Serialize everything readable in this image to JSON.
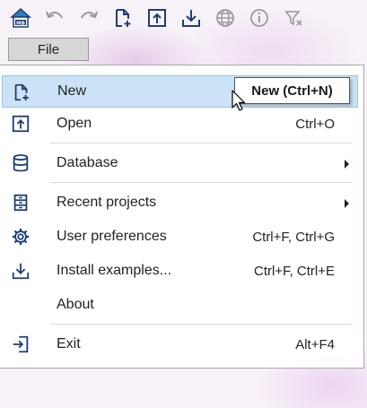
{
  "toolbar": {
    "buttons": [
      {
        "icon": "app-logo-icon"
      },
      {
        "icon": "undo-icon"
      },
      {
        "icon": "redo-icon"
      },
      {
        "icon": "new-document-icon"
      },
      {
        "icon": "open-icon"
      },
      {
        "icon": "download-icon"
      },
      {
        "icon": "globe-icon"
      },
      {
        "icon": "info-icon"
      },
      {
        "icon": "clear-filter-icon"
      }
    ]
  },
  "menubar": {
    "file_label": "File"
  },
  "menu": {
    "items": [
      {
        "label": "New",
        "shortcut": "",
        "icon": "new-document-icon",
        "highlighted": true
      },
      {
        "label": "Open",
        "shortcut": "Ctrl+O",
        "icon": "open-icon"
      },
      {
        "label": "Database",
        "shortcut": "",
        "icon": "database-icon",
        "submenu": true
      },
      {
        "label": "Recent projects",
        "shortcut": "",
        "icon": "recent-projects-icon",
        "submenu": true
      },
      {
        "label": "User preferences",
        "shortcut": "Ctrl+F, Ctrl+G",
        "icon": "gear-icon"
      },
      {
        "label": "Install examples...",
        "shortcut": "Ctrl+F, Ctrl+E",
        "icon": "download-icon"
      },
      {
        "label": "About",
        "shortcut": "",
        "icon": ""
      },
      {
        "label": "Exit",
        "shortcut": "Alt+F4",
        "icon": "exit-icon"
      }
    ]
  },
  "tooltip": {
    "text": "New (Ctrl+N)"
  },
  "colors": {
    "icon_blue": "#1f3f73",
    "highlight": "#cce2f6",
    "highlight_border": "#99c4e8"
  }
}
